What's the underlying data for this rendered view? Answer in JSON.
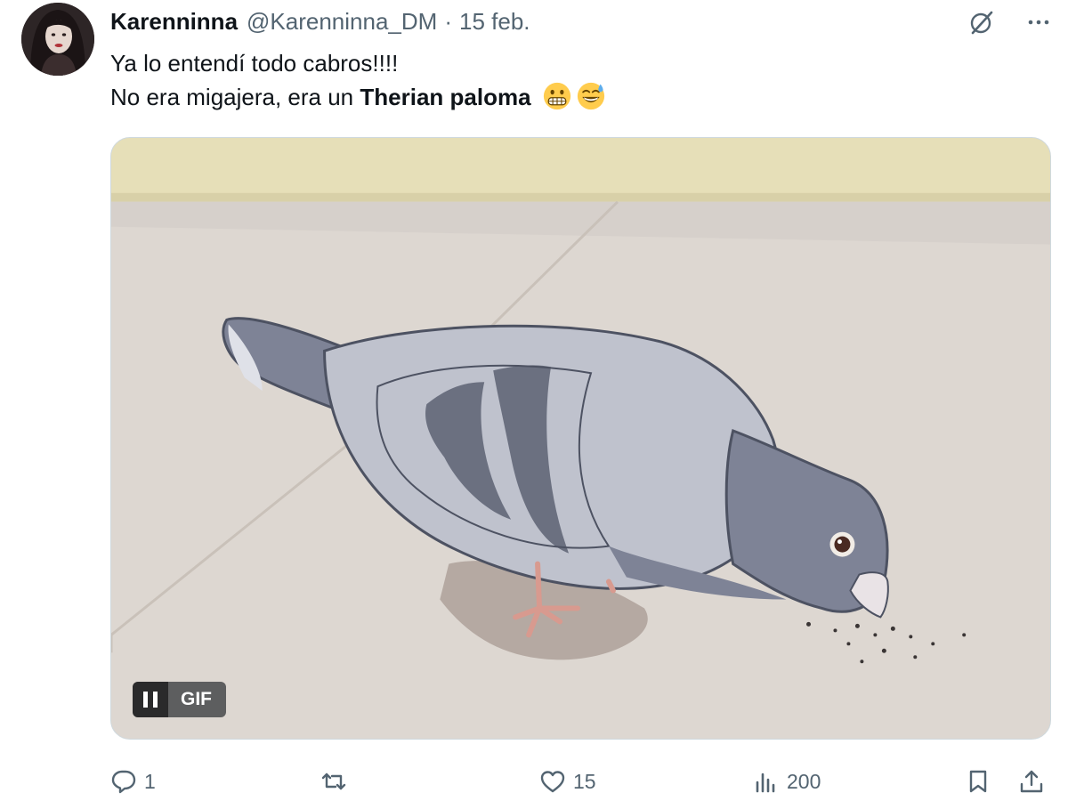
{
  "author": {
    "display_name": "Karenninna",
    "handle": "@Karenninna_DM",
    "separator": "·",
    "date": "15 feb."
  },
  "tweet": {
    "line1": "Ya lo entendí todo cabros!!!!",
    "line2_prefix": "No era migajera, era un ",
    "line2_bold": "Therian paloma",
    "emojis": [
      "grimacing-face",
      "grinning-face-with-sweat"
    ]
  },
  "media": {
    "type": "GIF",
    "badge_label": "GIF",
    "control": "pause-icon"
  },
  "actions": {
    "replies": "1",
    "reposts": "",
    "likes": "15",
    "views": "200"
  },
  "icons": {
    "grok": "grok-icon",
    "more": "more-icon",
    "reply": "reply-icon",
    "repost": "repost-icon",
    "like": "heart-icon",
    "views": "views-icon",
    "bookmark": "bookmark-icon",
    "share": "share-icon"
  },
  "colors": {
    "text_primary": "#0f1419",
    "text_secondary": "#536471",
    "border": "#cfd9de"
  }
}
